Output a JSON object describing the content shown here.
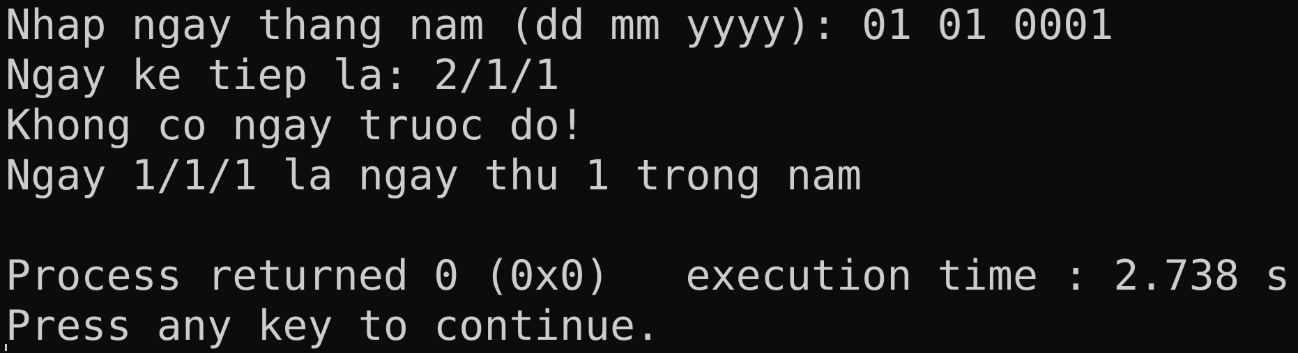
{
  "console": {
    "lines": [
      "Nhap ngay thang nam (dd mm yyyy): 01 01 0001",
      "Ngay ke tiep la: 2/1/1",
      "Khong co ngay truoc do!",
      "Ngay 1/1/1 la ngay thu 1 trong nam",
      "",
      "Process returned 0 (0x0)   execution time : 2.738 s",
      "Press any key to continue."
    ]
  },
  "colors": {
    "background": "#0c0c0c",
    "foreground": "#cccccc"
  }
}
